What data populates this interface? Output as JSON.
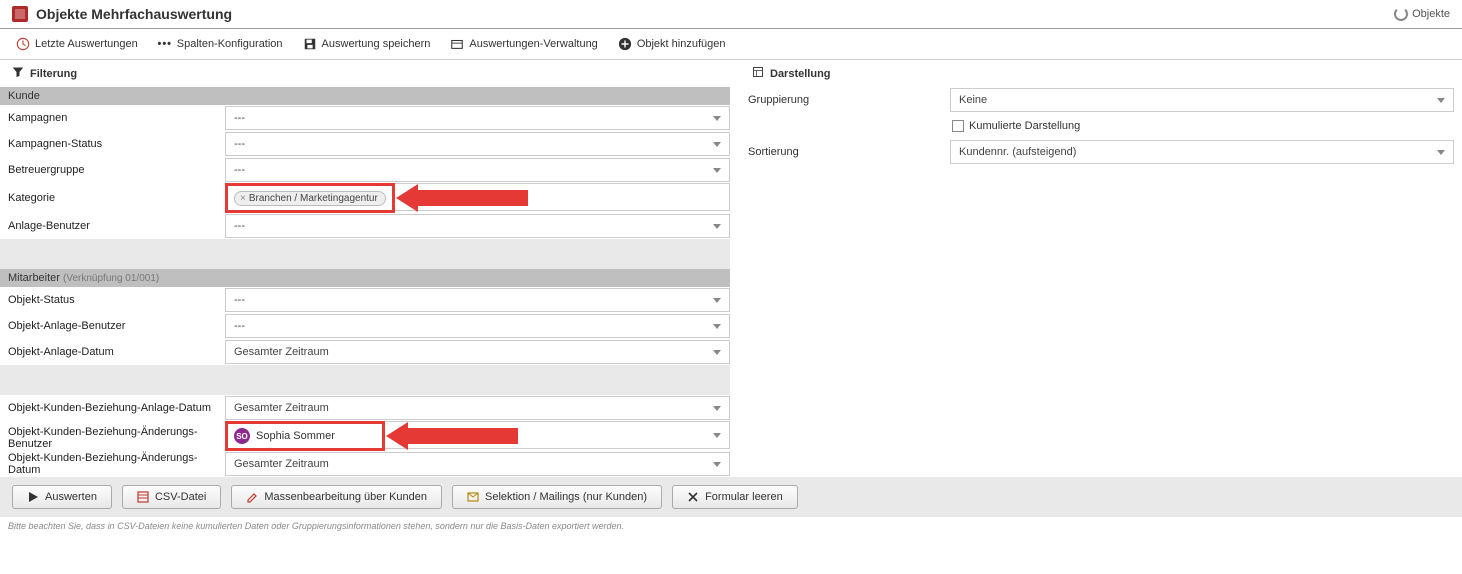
{
  "header": {
    "title": "Objekte Mehrfachauswertung",
    "breadcrumb": "Objekte"
  },
  "toolbar": {
    "recent": "Letzte Auswertungen",
    "columns": "Spalten-Konfiguration",
    "save": "Auswertung speichern",
    "manage": "Auswertungen-Verwaltung",
    "add": "Objekt hinzufügen"
  },
  "sections": {
    "filtering": "Filterung",
    "display": "Darstellung"
  },
  "groups": {
    "kunde": "Kunde",
    "mitarbeiter": "Mitarbeiter",
    "mitarbeiter_sub": "(Verknüpfung 01/001)"
  },
  "fields": {
    "kampagnen": {
      "label": "Kampagnen",
      "value": "---"
    },
    "kampagnen_status": {
      "label": "Kampagnen-Status",
      "value": "---"
    },
    "betreuergruppe": {
      "label": "Betreuergruppe",
      "value": "---"
    },
    "kategorie": {
      "label": "Kategorie",
      "tag": "Branchen / Marketingagentur"
    },
    "anlage_benutzer": {
      "label": "Anlage-Benutzer",
      "value": "---"
    },
    "objekt_status": {
      "label": "Objekt-Status",
      "value": "---"
    },
    "objekt_anlage_benutzer": {
      "label": "Objekt-Anlage-Benutzer",
      "value": "---"
    },
    "objekt_anlage_datum": {
      "label": "Objekt-Anlage-Datum",
      "value": "Gesamter Zeitraum"
    },
    "okb_anlage_datum": {
      "label": "Objekt-Kunden-Beziehung-Anlage-Datum",
      "value": "Gesamter Zeitraum"
    },
    "okb_aenderungs_benutzer": {
      "label": "Objekt-Kunden-Beziehung-Änderungs-Benutzer",
      "value": "Sophia Sommer",
      "initials": "SO"
    },
    "okb_aenderungs_datum": {
      "label": "Objekt-Kunden-Beziehung-Änderungs-Datum",
      "value": "Gesamter Zeitraum"
    }
  },
  "display": {
    "gruppierung_label": "Gruppierung",
    "gruppierung_value": "Keine",
    "kumuliert": "Kumulierte Darstellung",
    "sortierung_label": "Sortierung",
    "sortierung_value": "Kundennr. (aufsteigend)"
  },
  "actions": {
    "auswerten": "Auswerten",
    "csv": "CSV-Datei",
    "massen": "Massenbearbeitung über Kunden",
    "selektion": "Selektion / Mailings (nur Kunden)",
    "leeren": "Formular leeren"
  },
  "footer": "Bitte beachten Sie, dass in CSV-Dateien keine kumulierten Daten oder Gruppierungsinformationen stehen, sondern nur die Basis-Daten exportiert werden."
}
